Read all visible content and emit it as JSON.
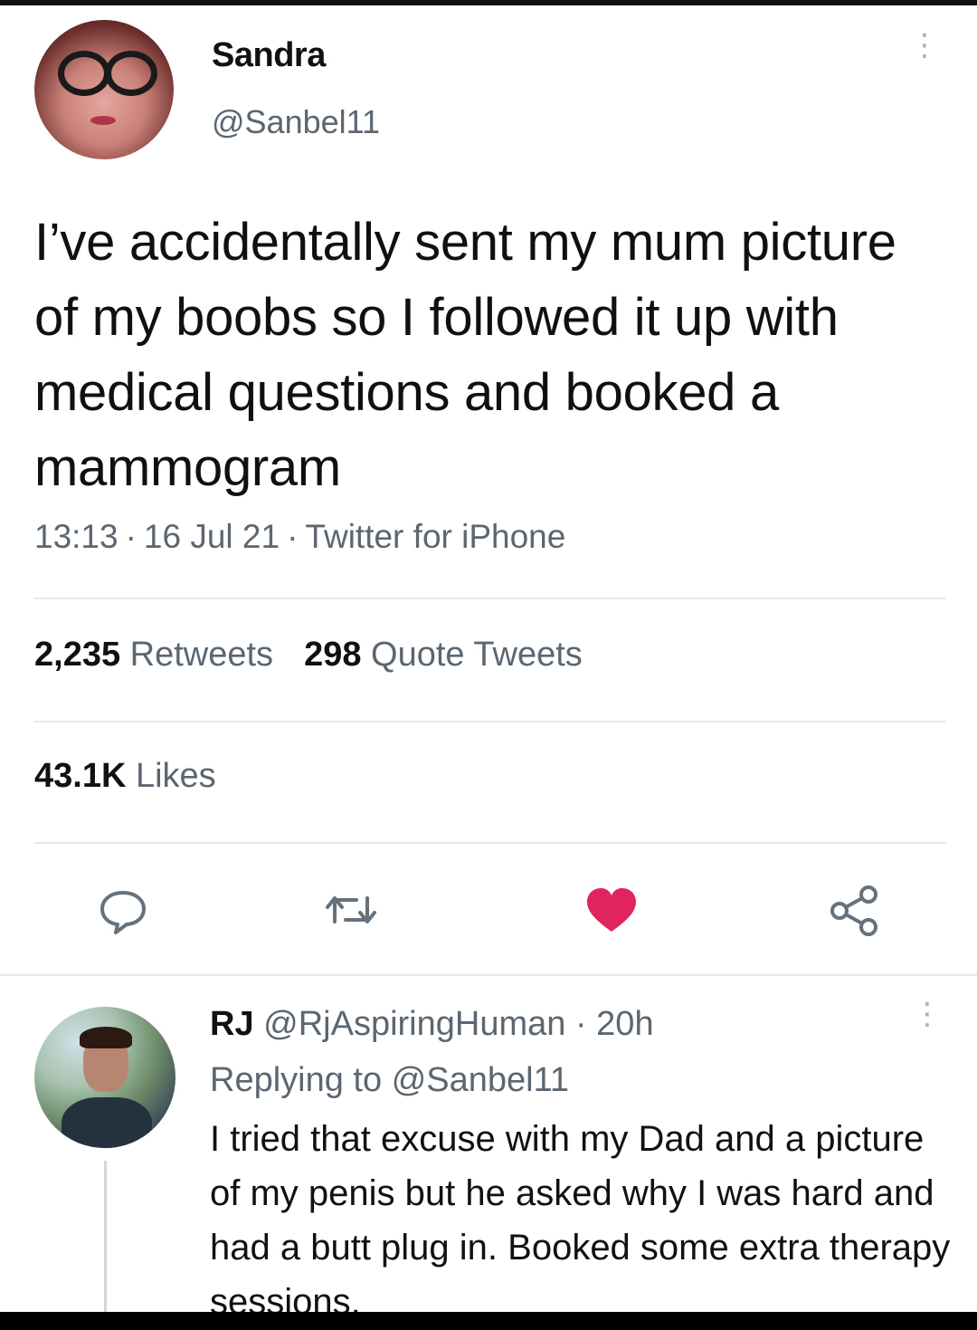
{
  "tweet": {
    "author_name": "Sandra",
    "author_handle": "@Sanbel11",
    "text": "I’ve accidentally sent my mum picture of my boobs so I followed it up with medical questions and booked a mammogram",
    "time": "13:13",
    "date": "16 Jul 21",
    "source": "Twitter for iPhone",
    "separator": "·",
    "retweets_count": "2,235",
    "retweets_label": "Retweets",
    "quotes_count": "298",
    "quotes_label": "Quote Tweets",
    "likes_count": "43.1K",
    "likes_label": "Likes",
    "liked": true,
    "like_color": "#e0245e",
    "more_icon": "vertical-dots-icon"
  },
  "actions": [
    "reply-icon",
    "retweet-icon",
    "like-icon",
    "share-icon"
  ],
  "reply": {
    "author_name": "RJ",
    "author_handle": "@RjAspiringHuman",
    "age": "20h",
    "separator": "·",
    "replying_prefix": "Replying to",
    "replying_to": "@Sanbel11",
    "text": "I tried that excuse with my Dad and a picture of my penis but he asked why I was hard and had a butt plug in. Booked some extra therapy sessions."
  }
}
